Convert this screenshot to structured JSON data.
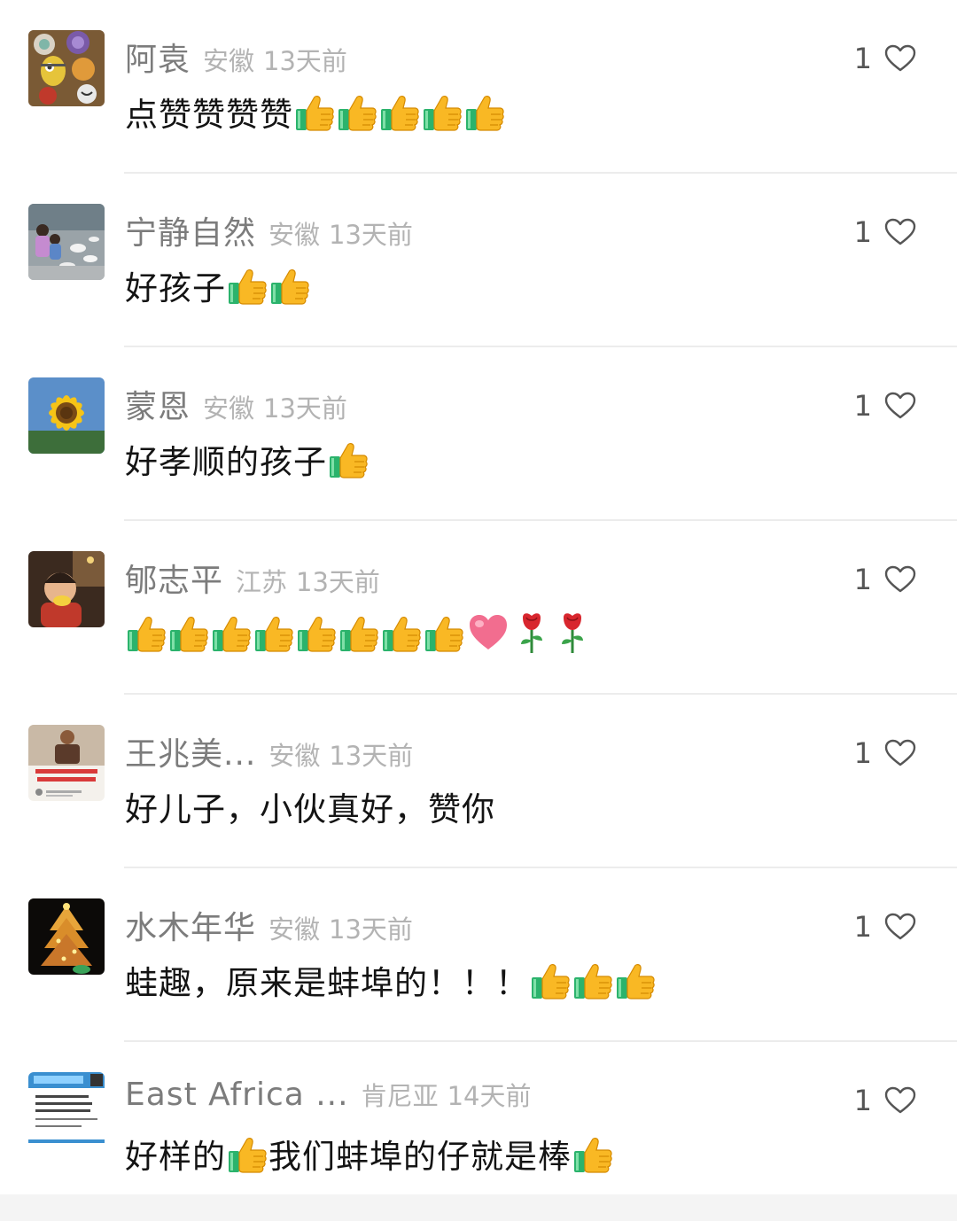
{
  "comments": [
    {
      "nickname": "阿袁",
      "region": "安徽",
      "time": "13天前",
      "likes": "1",
      "avatar": "cookies-avatar",
      "segments": [
        {
          "type": "text",
          "value": "点赞赞赞赞"
        },
        {
          "type": "thumb"
        },
        {
          "type": "thumb"
        },
        {
          "type": "thumb"
        },
        {
          "type": "thumb"
        },
        {
          "type": "thumb"
        }
      ]
    },
    {
      "nickname": "宁静自然",
      "region": "安徽",
      "time": "13天前",
      "likes": "1",
      "avatar": "kids-pigeons-avatar",
      "segments": [
        {
          "type": "text",
          "value": "好孩子"
        },
        {
          "type": "thumb"
        },
        {
          "type": "thumb"
        }
      ]
    },
    {
      "nickname": "蒙恩",
      "region": "安徽",
      "time": "13天前",
      "likes": "1",
      "avatar": "sunflower-avatar",
      "segments": [
        {
          "type": "text",
          "value": "好孝顺的孩子"
        },
        {
          "type": "thumb"
        }
      ]
    },
    {
      "nickname": "郇志平",
      "region": "江苏",
      "time": "13天前",
      "likes": "1",
      "avatar": "child-portrait-avatar",
      "segments": [
        {
          "type": "thumb"
        },
        {
          "type": "thumb"
        },
        {
          "type": "thumb"
        },
        {
          "type": "thumb"
        },
        {
          "type": "thumb"
        },
        {
          "type": "thumb"
        },
        {
          "type": "thumb"
        },
        {
          "type": "thumb"
        },
        {
          "type": "heart"
        },
        {
          "type": "rose"
        },
        {
          "type": "rose"
        }
      ]
    },
    {
      "nickname": "王兆美...",
      "region": "安徽",
      "time": "13天前",
      "likes": "1",
      "avatar": "poster-avatar",
      "segments": [
        {
          "type": "text",
          "value": "好儿子，小伙真好，赞你"
        }
      ]
    },
    {
      "nickname": "水木年华",
      "region": "安徽",
      "time": "13天前",
      "likes": "1",
      "avatar": "christmas-tree-avatar",
      "segments": [
        {
          "type": "text",
          "value": "蛙趣，原来是蚌埠的！！！"
        },
        {
          "type": "thumb"
        },
        {
          "type": "thumb"
        },
        {
          "type": "thumb"
        }
      ]
    },
    {
      "nickname": "East Africa ...",
      "region": "肯尼亚",
      "time": "14天前",
      "likes": "1",
      "avatar": "business-card-avatar",
      "segments": [
        {
          "type": "text",
          "value": "好样的"
        },
        {
          "type": "thumb"
        },
        {
          "type": "text",
          "value": "我们蚌埠的仔就是棒"
        },
        {
          "type": "thumb"
        }
      ]
    }
  ],
  "colors": {
    "nickname": "#7c7c7c",
    "meta": "#b3b3b3",
    "body_text": "#141414",
    "divider": "#ececec",
    "thumb_yellow": "#f9b824",
    "sleeve_green": "#2bb36c"
  },
  "icons": {
    "like": "heart-outline-icon",
    "thumb": "thumbs-up-emoji",
    "heart": "pink-heart-emoji",
    "rose": "rose-emoji"
  }
}
